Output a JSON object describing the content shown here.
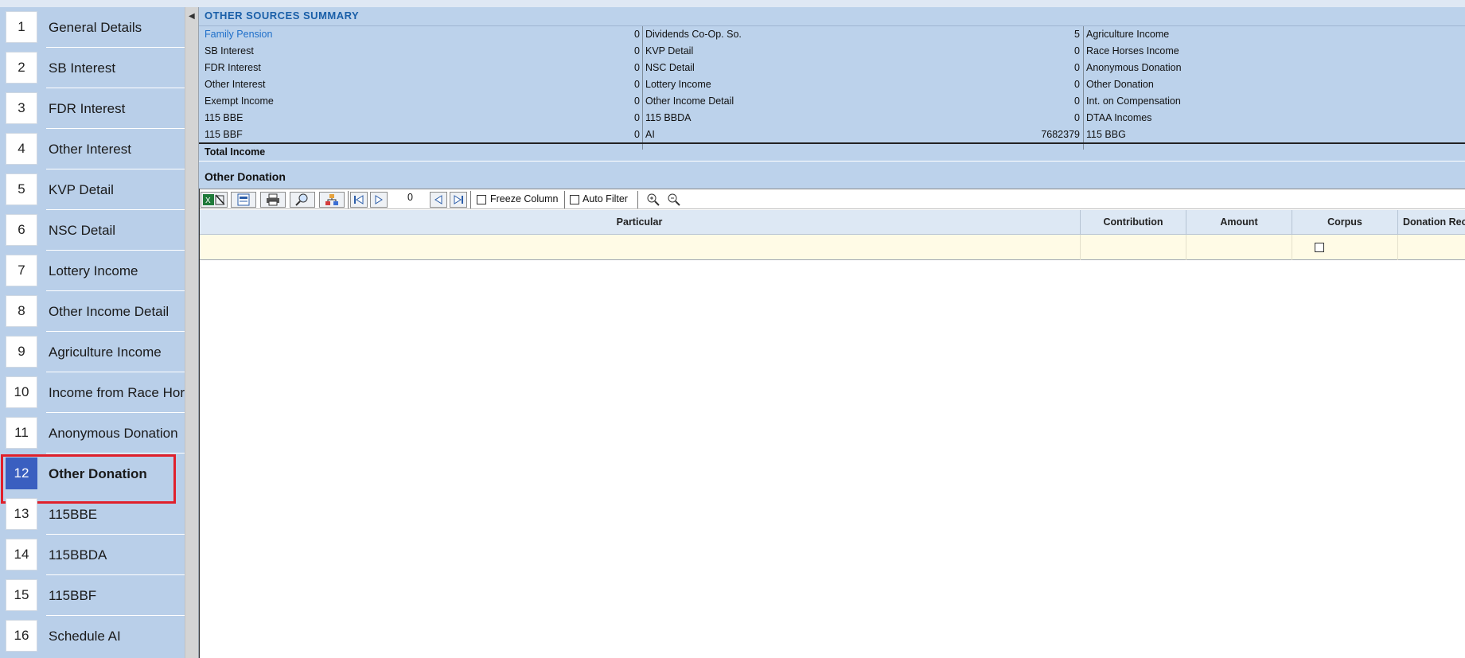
{
  "sidebar": {
    "items": [
      {
        "num": "1",
        "label": "General Details"
      },
      {
        "num": "2",
        "label": "SB Interest"
      },
      {
        "num": "3",
        "label": "FDR Interest"
      },
      {
        "num": "4",
        "label": "Other Interest"
      },
      {
        "num": "5",
        "label": "KVP Detail"
      },
      {
        "num": "6",
        "label": "NSC Detail"
      },
      {
        "num": "7",
        "label": "Lottery Income"
      },
      {
        "num": "8",
        "label": "Other Income Detail"
      },
      {
        "num": "9",
        "label": "Agriculture Income"
      },
      {
        "num": "10",
        "label": "Income from Race Horse"
      },
      {
        "num": "11",
        "label": "Anonymous Donation"
      },
      {
        "num": "12",
        "label": "Other Donation"
      },
      {
        "num": "13",
        "label": "115BBE"
      },
      {
        "num": "14",
        "label": "115BBDA"
      },
      {
        "num": "15",
        "label": "115BBF"
      },
      {
        "num": "16",
        "label": "Schedule AI"
      }
    ],
    "active_index": 11
  },
  "splitter": {
    "arrow": "◀"
  },
  "summary": {
    "title": "OTHER SOURCES SUMMARY",
    "rows": [
      {
        "c1": "Family Pension",
        "v1": "0",
        "c2": "Dividends Co-Op. So.",
        "v2": "5",
        "c3": "Agriculture Income"
      },
      {
        "c1": "SB Interest",
        "v1": "0",
        "c2": "KVP Detail",
        "v2": "0",
        "c3": "Race Horses Income"
      },
      {
        "c1": "FDR Interest",
        "v1": "0",
        "c2": "NSC Detail",
        "v2": "0",
        "c3": "Anonymous Donation"
      },
      {
        "c1": "Other Interest",
        "v1": "0",
        "c2": "Lottery Income",
        "v2": "0",
        "c3": "Other Donation"
      },
      {
        "c1": "Exempt Income",
        "v1": "0",
        "c2": "Other Income Detail",
        "v2": "0",
        "c3": "Int. on Compensation"
      },
      {
        "c1": "115 BBE",
        "v1": "0",
        "c2": "115 BBDA",
        "v2": "0",
        "c3": "DTAA Incomes"
      },
      {
        "c1": "115 BBF",
        "v1": "0",
        "c2": "AI",
        "v2": "7682379",
        "c3": "115 BBG"
      }
    ],
    "total_label": "Total Income",
    "section_title": "Other Donation"
  },
  "toolbar": {
    "record_count": "0",
    "freeze_column": "Freeze Column",
    "auto_filter": "Auto Filter",
    "icons": [
      "excel-export-icon",
      "csv-export-icon",
      "print-icon",
      "preview-icon",
      "group-icon",
      "first-record-icon",
      "next-record-icon",
      "prev-record-icon",
      "last-record-icon",
      "zoom-in-icon",
      "zoom-out-icon"
    ]
  },
  "grid": {
    "headers": [
      "Particular",
      "Contribution",
      "Amount",
      "Corpus",
      "Donation Rec"
    ]
  },
  "colors": {
    "sidebar_bg": "#b9cfe9",
    "active_num_bg": "#3a5fc0",
    "highlight_outline": "#e0202b",
    "summary_bg": "#bcd2eb",
    "title_color": "#1a5fa8",
    "grid_row_bg": "#fffbe6"
  }
}
